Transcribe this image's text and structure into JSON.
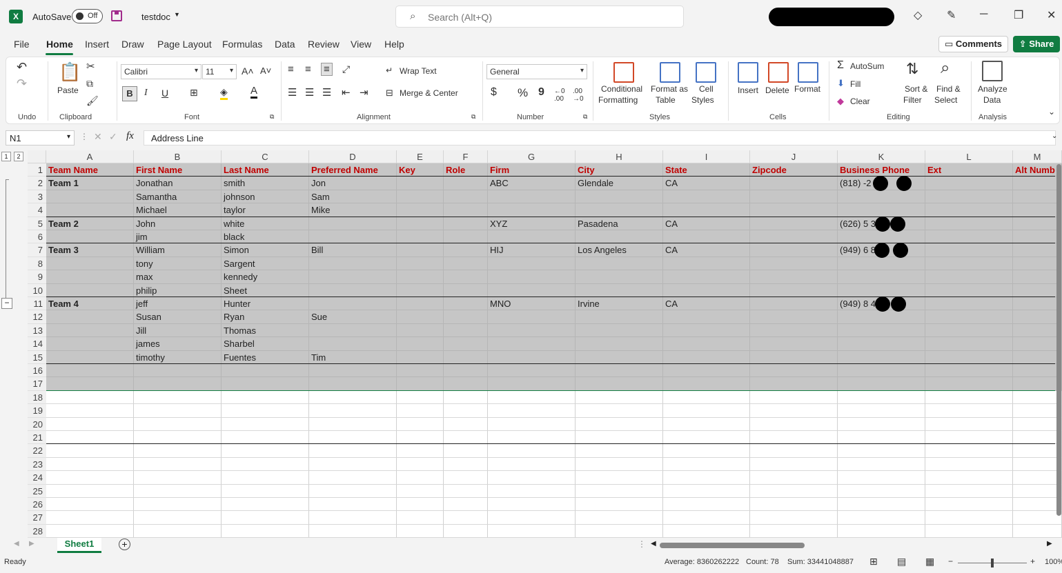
{
  "titlebar": {
    "autosave_label": "AutoSave",
    "autosave_state": "Off",
    "doc_name": "testdoc",
    "search_placeholder": "Search (Alt+Q)"
  },
  "menu": [
    "File",
    "Home",
    "Insert",
    "Draw",
    "Page Layout",
    "Formulas",
    "Data",
    "Review",
    "View",
    "Help"
  ],
  "actions": {
    "comments": "Comments",
    "share": "Share"
  },
  "ribbon": {
    "undo_group": "Undo",
    "clipboard": {
      "paste": "Paste",
      "group": "Clipboard"
    },
    "font": {
      "name": "Calibri",
      "size": "11",
      "group": "Font",
      "bold": "B",
      "italic": "I",
      "underline": "U"
    },
    "alignment": {
      "wrap": "Wrap Text",
      "merge": "Merge & Center",
      "group": "Alignment"
    },
    "number": {
      "format": "General",
      "group": "Number",
      "currency": "$",
      "percent": "%",
      "comma": "9"
    },
    "styles": {
      "conditional": [
        "Conditional",
        "Formatting"
      ],
      "format_table": [
        "Format as",
        "Table"
      ],
      "cell_styles": [
        "Cell",
        "Styles"
      ],
      "group": "Styles"
    },
    "cells": {
      "insert": "Insert",
      "delete": "Delete",
      "format": "Format",
      "group": "Cells"
    },
    "editing": {
      "autosum": "AutoSum",
      "fill": "Fill",
      "clear": "Clear",
      "sort": [
        "Sort &",
        "Filter"
      ],
      "find": [
        "Find &",
        "Select"
      ],
      "group": "Editing"
    },
    "analysis": {
      "analyze": [
        "Analyze",
        "Data"
      ],
      "group": "Analysis"
    }
  },
  "formula_bar": {
    "name_box": "N1",
    "fx": "fx",
    "content": "Address Line"
  },
  "outline_levels": [
    "1",
    "2"
  ],
  "columns": [
    "A",
    "B",
    "C",
    "D",
    "E",
    "F",
    "G",
    "H",
    "I",
    "J",
    "K",
    "L",
    "M"
  ],
  "row_numbers": [
    "1",
    "2",
    "3",
    "4",
    "5",
    "6",
    "7",
    "8",
    "9",
    "10",
    "11",
    "12",
    "13",
    "14",
    "15",
    "16",
    "17",
    "18",
    "19",
    "20",
    "21",
    "22",
    "23",
    "24",
    "25",
    "26",
    "27",
    "28"
  ],
  "header_row": [
    "Team Name",
    "First Name",
    "Last Name",
    "Preferred Name",
    "Key",
    "Role",
    "Firm",
    "City",
    "State",
    "Zipcode",
    "Business Phone",
    "Ext",
    "Alt Numb"
  ],
  "rows": [
    [
      "Team 1",
      "Jonathan",
      "smith",
      "Jon",
      "",
      "",
      "ABC",
      "Glendale",
      "CA",
      "",
      "(818)   -2",
      "",
      ""
    ],
    [
      "",
      "Samantha",
      "johnson",
      "Sam",
      "",
      "",
      "",
      "",
      "",
      "",
      "",
      "",
      ""
    ],
    [
      "",
      "Michael",
      "taylor",
      "Mike",
      "",
      "",
      "",
      "",
      "",
      "",
      "",
      "",
      ""
    ],
    [
      "Team 2",
      "John",
      "white",
      "",
      "",
      "",
      "XYZ",
      "Pasadena",
      "CA",
      "",
      "(626) 5     3",
      "",
      ""
    ],
    [
      "",
      "jim",
      "black",
      "",
      "",
      "",
      "",
      "",
      "",
      "",
      "",
      "",
      ""
    ],
    [
      "Team 3",
      "William",
      "Simon",
      "Bill",
      "",
      "",
      "HIJ",
      "Los Angeles",
      "CA",
      "",
      "(949) 6   8   8",
      "",
      ""
    ],
    [
      "",
      "tony",
      "Sargent",
      "",
      "",
      "",
      "",
      "",
      "",
      "",
      "",
      "",
      ""
    ],
    [
      "",
      "max",
      "kennedy",
      "",
      "",
      "",
      "",
      "",
      "",
      "",
      "",
      "",
      ""
    ],
    [
      "",
      "philip",
      "Sheet",
      "",
      "",
      "",
      "",
      "",
      "",
      "",
      "",
      "",
      ""
    ],
    [
      "Team 4",
      "jeff",
      "Hunter",
      "",
      "",
      "",
      "MNO",
      "Irvine",
      "CA",
      "",
      "(949) 8       4",
      "",
      ""
    ],
    [
      "",
      "Susan",
      "Ryan",
      "Sue",
      "",
      "",
      "",
      "",
      "",
      "",
      "",
      "",
      ""
    ],
    [
      "",
      "Jill",
      "Thomas",
      "",
      "",
      "",
      "",
      "",
      "",
      "",
      "",
      "",
      ""
    ],
    [
      "",
      "james",
      "Sharbel",
      "",
      "",
      "",
      "",
      "",
      "",
      "",
      "",
      "",
      ""
    ],
    [
      "",
      "timothy",
      "Fuentes",
      "Tim",
      "",
      "",
      "",
      "",
      "",
      "",
      "",
      "",
      ""
    ],
    [
      "",
      "",
      "",
      "",
      "",
      "",
      "",
      "",
      "",
      "",
      "",
      "",
      ""
    ],
    [
      "",
      "",
      "",
      "",
      "",
      "",
      "",
      "",
      "",
      "",
      "",
      "",
      ""
    ]
  ],
  "sheet_tab": "Sheet1",
  "status": {
    "ready": "Ready",
    "average": "Average: 8360262222",
    "count": "Count: 78",
    "sum": "Sum: 33441048887",
    "zoom": "100%"
  }
}
